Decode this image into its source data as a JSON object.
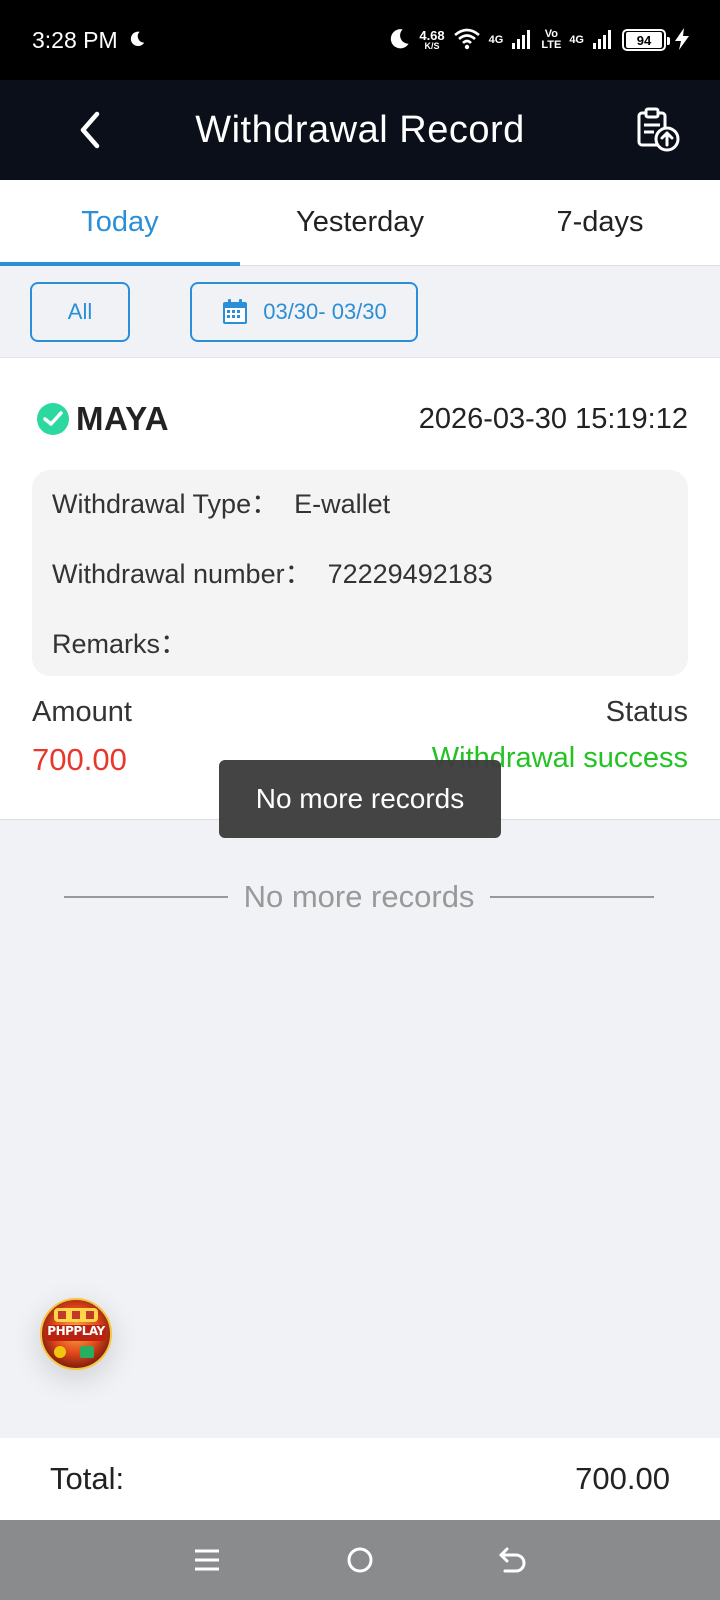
{
  "status_bar": {
    "time": "3:28 PM",
    "net_speed_value": "4.68",
    "net_speed_unit": "K/S",
    "sim1_label": "4G",
    "volte_top": "Vo",
    "volte_bottom": "LTE",
    "sim2_label": "4G",
    "battery": "94"
  },
  "header": {
    "title": "Withdrawal Record"
  },
  "tabs": [
    {
      "label": "Today",
      "active": true
    },
    {
      "label": "Yesterday",
      "active": false
    },
    {
      "label": "7-days",
      "active": false
    }
  ],
  "filters": {
    "all_label": "All",
    "date_range": "03/30- 03/30"
  },
  "record": {
    "brand": "MAYA",
    "datetime": "2026-03-30 15:19:12",
    "type_label": "Withdrawal Type：",
    "type_value": "E-wallet",
    "number_label": "Withdrawal number：",
    "number_value": "72229492183",
    "remarks_label": "Remarks：",
    "remarks_value": "",
    "amount_label": "Amount",
    "amount_value": "700.00",
    "status_label": "Status",
    "status_value": "Withdrawal success"
  },
  "toast": "No more records",
  "end_text": "No more records",
  "float_logo_text": "PHPPLAY",
  "total": {
    "label": "Total:",
    "value": "700.00"
  },
  "colors": {
    "accent": "#2b8fd8",
    "amount": "#e8382b",
    "success": "#22c322",
    "header_bg": "#0a0f1a",
    "maya_green": "#2bd9a0"
  }
}
